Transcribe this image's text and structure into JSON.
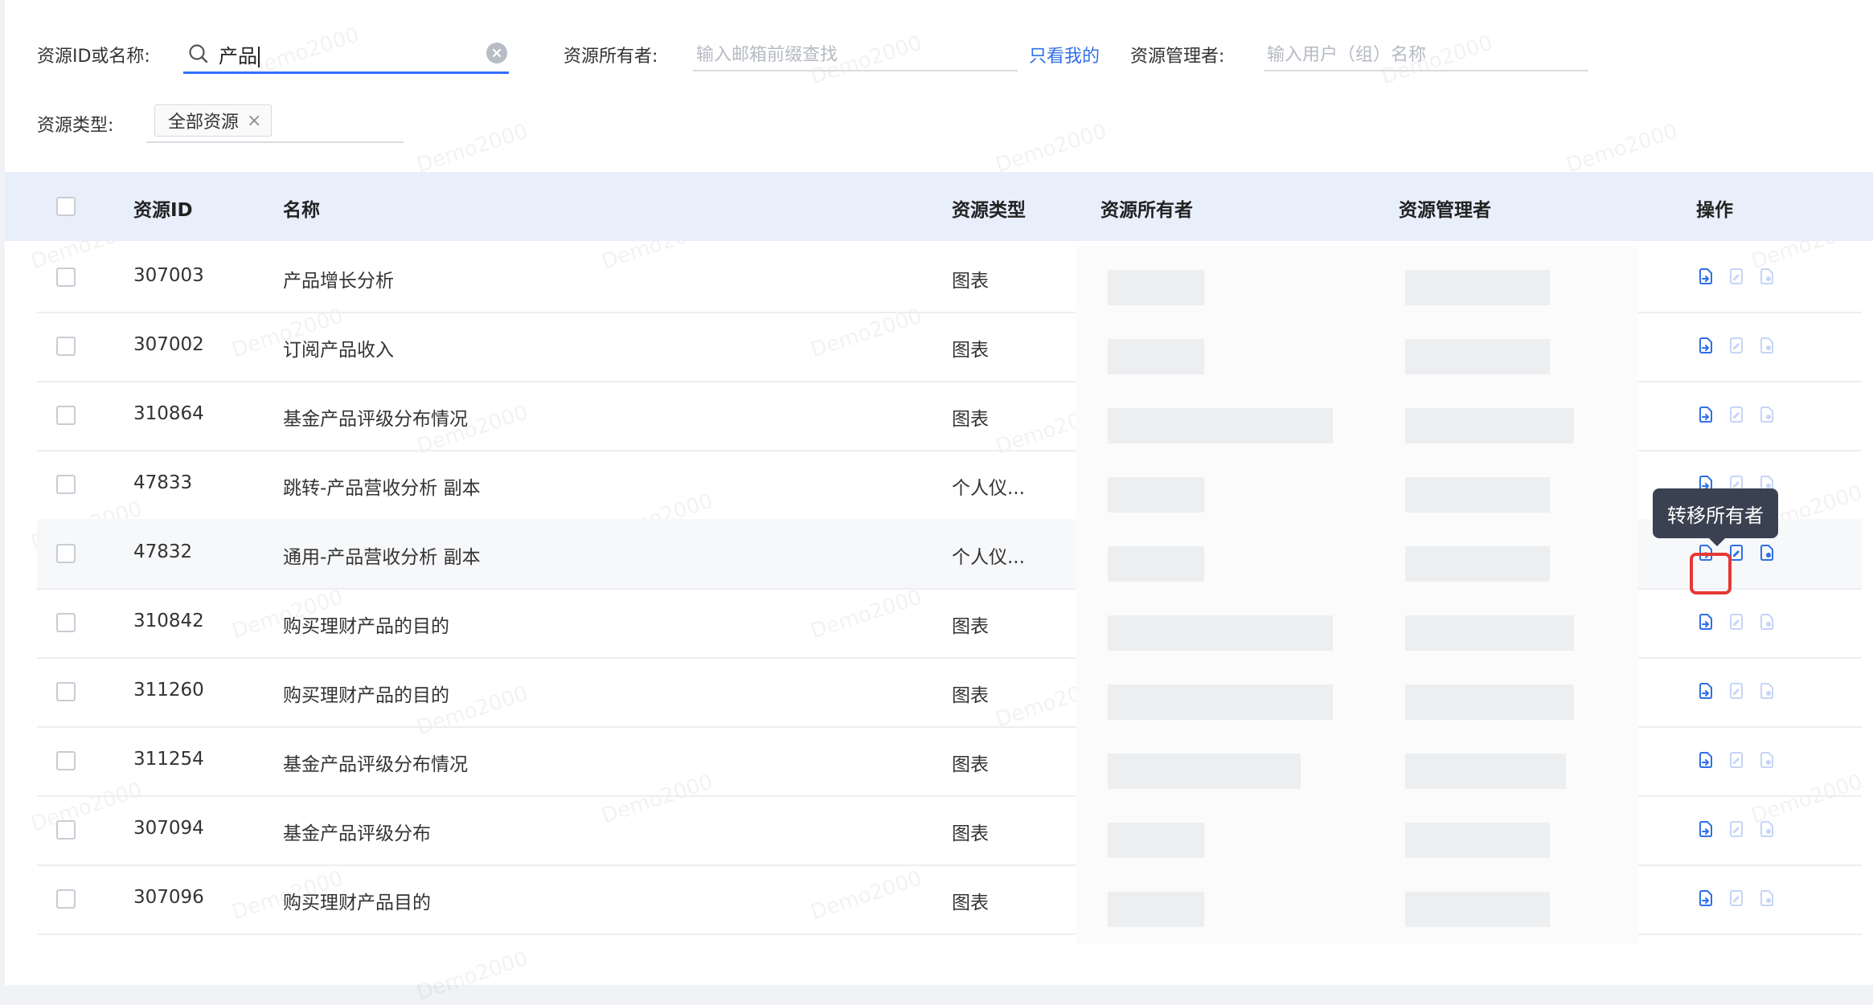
{
  "filters": {
    "id_name_label": "资源ID或名称:",
    "search_value": "产品",
    "owner_label": "资源所有者:",
    "owner_placeholder": "输入邮箱前缀查找",
    "only_mine_link": "只看我的",
    "manager_label": "资源管理者:",
    "manager_placeholder": "输入用户（组）名称",
    "type_label": "资源类型:",
    "type_tag": "全部资源",
    "type_tag_remove": "×"
  },
  "table": {
    "headers": {
      "id": "资源ID",
      "name": "名称",
      "type": "资源类型",
      "owner": "资源所有者",
      "manager": "资源管理者",
      "actions": "操作"
    },
    "rows": [
      {
        "id": "307003",
        "name": "产品增长分析",
        "type": "图表"
      },
      {
        "id": "307002",
        "name": "订阅产品收入",
        "type": "图表"
      },
      {
        "id": "310864",
        "name": "基金产品评级分布情况",
        "type": "图表"
      },
      {
        "id": "47833",
        "name": "跳转-产品营收分析 副本",
        "type": "个人仪..."
      },
      {
        "id": "47832",
        "name": "通用-产品营收分析 副本",
        "type": "个人仪..."
      },
      {
        "id": "310842",
        "name": "购买理财产品的目的",
        "type": "图表"
      },
      {
        "id": "311260",
        "name": "购买理财产品的目的",
        "type": "图表"
      },
      {
        "id": "311254",
        "name": "基金产品评级分布情况",
        "type": "图表"
      },
      {
        "id": "307094",
        "name": "基金产品评级分布",
        "type": "图表"
      },
      {
        "id": "307096",
        "name": "购买理财产品目的",
        "type": "图表"
      }
    ]
  },
  "tooltip": "转移所有者",
  "watermark": "Demo2000",
  "colors": {
    "accent": "#3370ff",
    "link": "#2f6fe8",
    "header_bg": "#e9eefb",
    "highlight": "#e53935",
    "tooltip_bg": "#3a4150"
  },
  "icons": [
    "transfer-owner-icon",
    "edit-manager-icon",
    "permission-file-icon"
  ]
}
